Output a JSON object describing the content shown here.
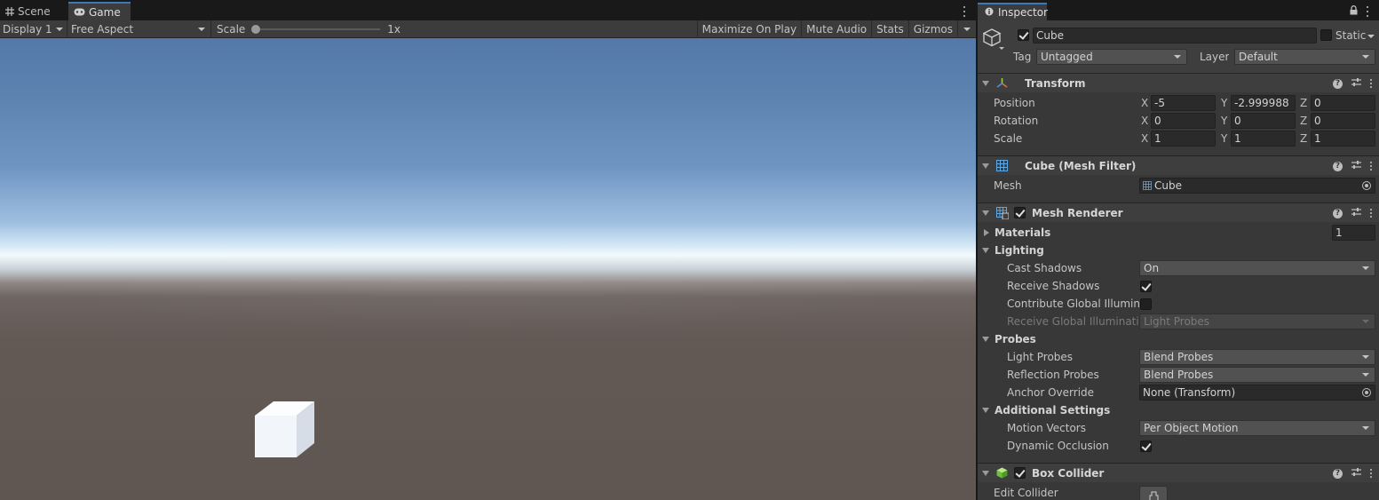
{
  "game_tabs": {
    "scene": "Scene",
    "game": "Game"
  },
  "game_toolbar": {
    "display": "Display 1",
    "aspect": "Free Aspect",
    "scale_label": "Scale",
    "scale_value": "1x",
    "maximize_on_play": "Maximize On Play",
    "mute_audio": "Mute Audio",
    "stats": "Stats",
    "gizmos": "Gizmos"
  },
  "inspector": {
    "tab_label": "Inspector",
    "object": {
      "active": true,
      "name": "Cube",
      "static_label": "Static",
      "static_checked": false,
      "tag_label": "Tag",
      "tag_value": "Untagged",
      "layer_label": "Layer",
      "layer_value": "Default"
    },
    "transform": {
      "title": "Transform",
      "position_label": "Position",
      "rotation_label": "Rotation",
      "scale_label": "Scale",
      "axis_x": "X",
      "axis_y": "Y",
      "axis_z": "Z",
      "position": {
        "x": "-5",
        "y": "-2.999988",
        "z": "0"
      },
      "rotation": {
        "x": "0",
        "y": "0",
        "z": "0"
      },
      "scale": {
        "x": "1",
        "y": "1",
        "z": "1"
      }
    },
    "mesh_filter": {
      "title": "Cube (Mesh Filter)",
      "mesh_label": "Mesh",
      "mesh_value": "Cube"
    },
    "mesh_renderer": {
      "title": "Mesh Renderer",
      "enabled": true,
      "materials_label": "Materials",
      "materials_count": "1",
      "lighting_label": "Lighting",
      "cast_shadows_label": "Cast Shadows",
      "cast_shadows_value": "On",
      "receive_shadows_label": "Receive Shadows",
      "receive_shadows": true,
      "contribute_gi_label": "Contribute Global Illuminat",
      "contribute_gi": false,
      "receive_gi_label": "Receive Global Illuminatior",
      "receive_gi_value": "Light Probes",
      "probes_label": "Probes",
      "light_probes_label": "Light Probes",
      "light_probes_value": "Blend Probes",
      "reflection_probes_label": "Reflection Probes",
      "reflection_probes_value": "Blend Probes",
      "anchor_override_label": "Anchor Override",
      "anchor_override_value": "None (Transform)",
      "additional_settings_label": "Additional Settings",
      "motion_vectors_label": "Motion Vectors",
      "motion_vectors_value": "Per Object Motion",
      "dynamic_occlusion_label": "Dynamic Occlusion",
      "dynamic_occlusion": true
    },
    "box_collider": {
      "title": "Box Collider",
      "enabled": true,
      "edit_collider_label": "Edit Collider"
    }
  },
  "icons": {
    "scene_tab": "grid-icon",
    "game_tab": "gamepad-icon",
    "inspector_tab": "info-icon",
    "transform": "transform-axes-icon",
    "mesh_filter": "mesh-grid-icon",
    "mesh_renderer": "mesh-renderer-icon",
    "box_collider": "box-collider-icon"
  },
  "colors": {
    "accent_tab": "#3a79bb",
    "panel_bg": "#383838",
    "sky_top": "#5479a9",
    "horizon": "#f3fafc",
    "ground": "#5f5551"
  }
}
